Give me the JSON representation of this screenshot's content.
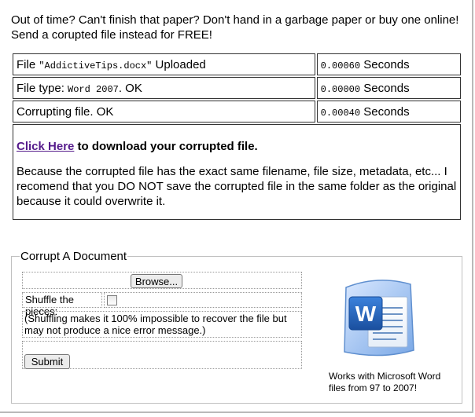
{
  "intro": "Out of time? Can't finish that paper? Don't hand in a garbage paper or buy one online! Send a corupted file instead for FREE!",
  "status": [
    {
      "prefix": "File ",
      "code": "\"AddictiveTips.docx\"",
      "suffix": " Uploaded",
      "time": "0.00060",
      "unit": " Seconds"
    },
    {
      "prefix": "File type: ",
      "code": "Word 2007",
      "suffix": ". OK",
      "time": "0.00000",
      "unit": " Seconds"
    },
    {
      "prefix": "Corrupting file. OK",
      "code": "",
      "suffix": "",
      "time": "0.00040",
      "unit": " Seconds"
    }
  ],
  "result": {
    "link": "Click Here",
    "link_suffix": " to download your corrupted file.",
    "warning": "Because the corrupted file has the exact same filename, file size, metadata, etc... I recomend that you DO NOT save the corrupted file in the same folder as the original because it could overwrite it."
  },
  "form": {
    "legend": "Corrupt A Document",
    "file_value": "",
    "browse_label": "Browse...",
    "shuffle_label": "Shuffle the pieces:",
    "shuffle_checked": false,
    "note": "(Shuffling makes it 100% impossible to recover the file but may not produce a nice error message.)",
    "submit_label": "Submit"
  },
  "side": {
    "works_with": "Works with Microsoft Word files from 97 to 2007!",
    "icon": "microsoft-word-icon",
    "accent": "#1f5fb8"
  }
}
